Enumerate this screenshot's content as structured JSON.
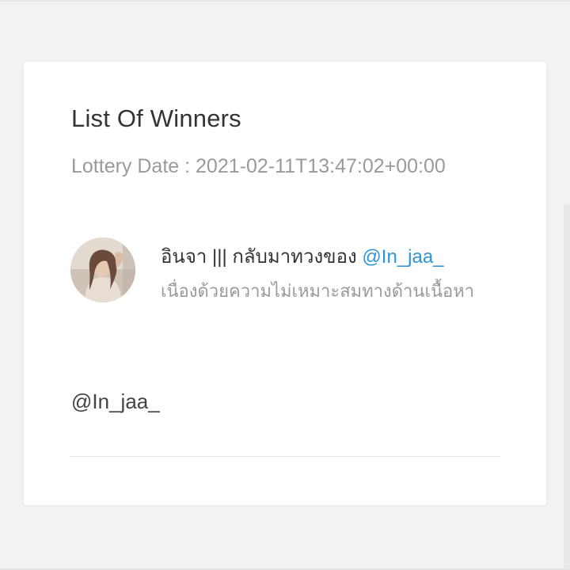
{
  "card": {
    "title": "List Of Winners",
    "lottery_date": "Lottery Date : 2021-02-11T13:47:02+00:00"
  },
  "entry": {
    "display_name": "อินจา ||| กลับมาทวงของ",
    "handle": "@In_jaa_",
    "text": "เนื่องด้วยความไม่เหมาะสมทางด้านเนื้อหา"
  },
  "winners": [
    {
      "handle": "@In_jaa_"
    }
  ],
  "colors": {
    "page_background": "#f2f2f2",
    "card_background": "#ffffff",
    "title_text": "#333333",
    "muted_text": "#9a9a9a",
    "link": "#2f95d6"
  },
  "icons": {
    "avatar": "profile-photo"
  }
}
